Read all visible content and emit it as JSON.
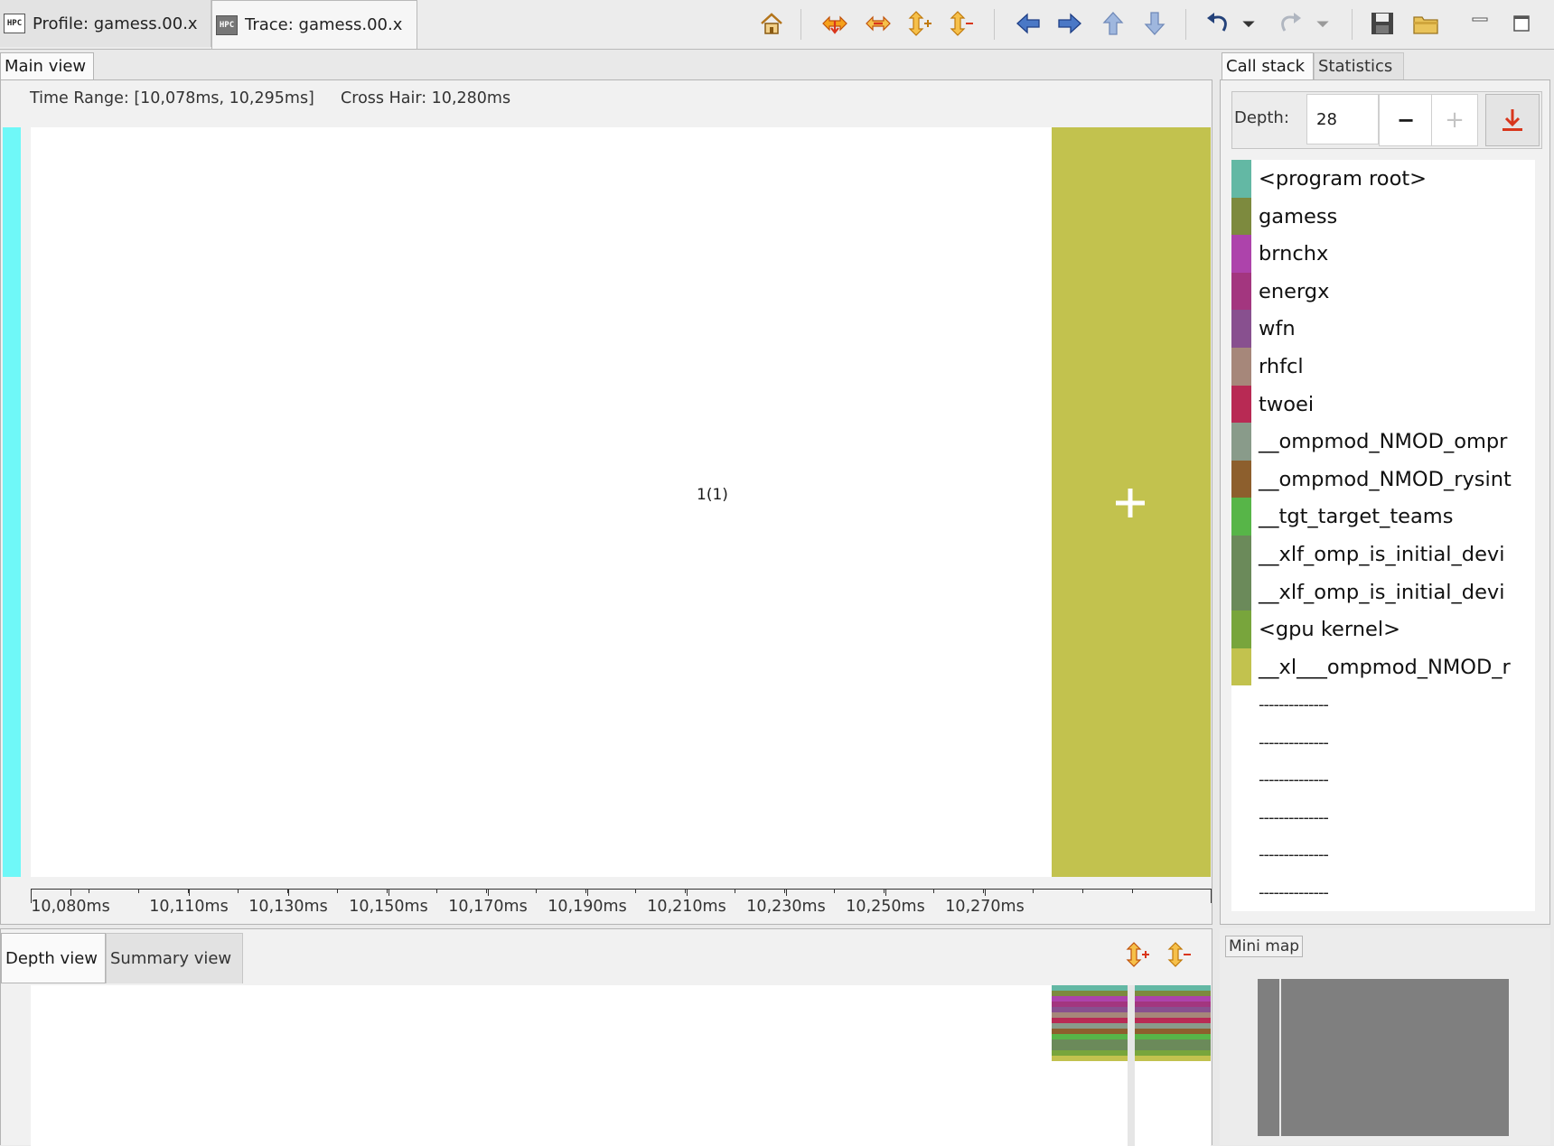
{
  "editor_tabs": [
    {
      "label": "Profile: gamess.00.x",
      "icon": "hpc-profile-icon"
    },
    {
      "label": "Trace: gamess.00.x",
      "icon": "hpc-trace-icon"
    }
  ],
  "toolbar_icons": [
    "home-icon",
    "expand-horizontal-icon",
    "shrink-horizontal-icon",
    "expand-vertical-icon",
    "shrink-vertical-icon",
    "arrow-left-icon",
    "arrow-right-icon",
    "arrow-up-icon",
    "arrow-down-icon",
    "undo-icon",
    "undo-dropdown-icon",
    "redo-icon",
    "redo-dropdown-icon",
    "save-icon",
    "open-folder-icon",
    "minimize-icon",
    "maximize-icon"
  ],
  "main_view": {
    "tab_label": "Main view",
    "time_range_text": "Time Range: [10,078ms, 10,295ms]",
    "cross_hair_text": "Cross Hair: 10,280ms",
    "center_label": "1(1)",
    "axis_ticks": [
      "10,080ms",
      "10,110ms",
      "10,130ms",
      "10,150ms",
      "10,170ms",
      "10,190ms",
      "10,210ms",
      "10,230ms",
      "10,250ms",
      "10,270ms"
    ],
    "colors": {
      "process_bar": "#6ff8f8",
      "trace_block": "#c2c24e"
    }
  },
  "call_stack": {
    "tabs": [
      "Call stack",
      "Statistics"
    ],
    "depth_label": "Depth:",
    "depth_value": "28",
    "minus_label": "−",
    "plus_label": "+",
    "frames": [
      {
        "name": "<program root>",
        "color": "#63b8a4"
      },
      {
        "name": "gamess",
        "color": "#7d8a3e"
      },
      {
        "name": "brnchx",
        "color": "#ad43ab"
      },
      {
        "name": "energx",
        "color": "#a3367f"
      },
      {
        "name": "wfn",
        "color": "#88508f"
      },
      {
        "name": "rhfcl",
        "color": "#a6877a"
      },
      {
        "name": "twoei",
        "color": "#b82a54"
      },
      {
        "name": "__ompmod_NMOD_ompr",
        "color": "#899b8a"
      },
      {
        "name": "__ompmod_NMOD_rysint",
        "color": "#8d5f2d"
      },
      {
        "name": "__tgt_target_teams",
        "color": "#57b548"
      },
      {
        "name": "__xlf_omp_is_initial_devi",
        "color": "#6b8a5a"
      },
      {
        "name": "__xlf_omp_is_initial_devi",
        "color": "#6b8a5a"
      },
      {
        "name": "<gpu kernel>",
        "color": "#78a53c"
      },
      {
        "name": "__xl___ompmod_NMOD_r",
        "color": "#c2c24e"
      },
      {
        "name": "--------------",
        "color": ""
      },
      {
        "name": "--------------",
        "color": ""
      },
      {
        "name": "--------------",
        "color": ""
      },
      {
        "name": "--------------",
        "color": ""
      },
      {
        "name": "--------------",
        "color": ""
      },
      {
        "name": "--------------",
        "color": ""
      }
    ]
  },
  "depth_view": {
    "tabs": [
      "Depth view",
      "Summary view"
    ],
    "stripe_colors": [
      "#63b8a4",
      "#7d8a3e",
      "#ad43ab",
      "#a3367f",
      "#88508f",
      "#a6877a",
      "#b82a54",
      "#899b8a",
      "#8d5f2d",
      "#57b548",
      "#6b8a5a",
      "#6b8a5a",
      "#78a53c",
      "#c2c24e"
    ]
  },
  "mini_map": {
    "label": "Mini map"
  }
}
